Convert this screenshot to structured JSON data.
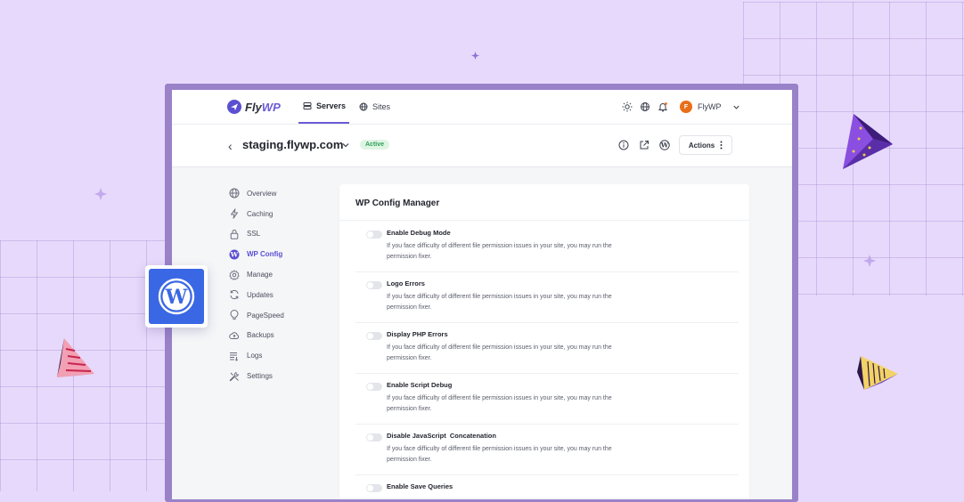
{
  "brand": {
    "logo_text": "Fly",
    "logo_text_accent": "WP"
  },
  "topnav": {
    "tabs": [
      {
        "label": "Servers",
        "icon": "server-icon",
        "active": true
      },
      {
        "label": "Sites",
        "icon": "globe-icon",
        "active": false
      }
    ],
    "icons": [
      "sun-icon",
      "globe-icon",
      "bell-icon"
    ],
    "user": {
      "initial": "F",
      "name": "FlyWP"
    }
  },
  "site": {
    "name": "staging.flywp.com",
    "status": "Active",
    "icons": [
      "info-icon",
      "external-link-icon",
      "wordpress-icon"
    ],
    "actions_label": "Actions"
  },
  "sidebar": {
    "items": [
      {
        "label": "Overview",
        "icon": "globe-icon",
        "active": false
      },
      {
        "label": "Caching",
        "icon": "bolt-icon",
        "active": false
      },
      {
        "label": "SSL",
        "icon": "lock-icon",
        "active": false
      },
      {
        "label": "WP Config",
        "icon": "wordpress-icon",
        "active": true
      },
      {
        "label": "Manage",
        "icon": "gear-icon",
        "active": false
      },
      {
        "label": "Updates",
        "icon": "refresh-icon",
        "active": false
      },
      {
        "label": "PageSpeed",
        "icon": "lightbulb-icon",
        "active": false
      },
      {
        "label": "Backups",
        "icon": "cloud-upload-icon",
        "active": false
      },
      {
        "label": "Logs",
        "icon": "list-icon",
        "active": false
      },
      {
        "label": "Settings",
        "icon": "tools-icon",
        "active": false
      }
    ]
  },
  "main": {
    "title": "WP Config Manager",
    "settings": [
      {
        "title": "Enable Debug Mode",
        "description": "If you face difficulty of different file permission issues in your site, you may run the permission fixer.",
        "enabled": false
      },
      {
        "title": "Logo Errors",
        "description": "If you face difficulty of different file permission issues in your site, you may run the permission fixer.",
        "enabled": false
      },
      {
        "title": "Display PHP Errors",
        "description": "If you face difficulty of different file permission issues in your site, you may run the permission fixer.",
        "enabled": false
      },
      {
        "title": "Enable Script Debug",
        "description": "If you face difficulty of different file permission issues in your site, you may run the permission fixer.",
        "enabled": false
      },
      {
        "title": "Disable JavaScript  Concatenation",
        "description": "If you face difficulty of different file permission issues in your site, you may run the permission fixer.",
        "enabled": false
      },
      {
        "title": "Enable Save Queries",
        "description": "",
        "enabled": false
      }
    ]
  },
  "colors": {
    "accent": "#6b5bd6",
    "background": "#e7d9fb",
    "active_badge": "#2e9e55",
    "wordpress_tile": "#3a67e3"
  }
}
